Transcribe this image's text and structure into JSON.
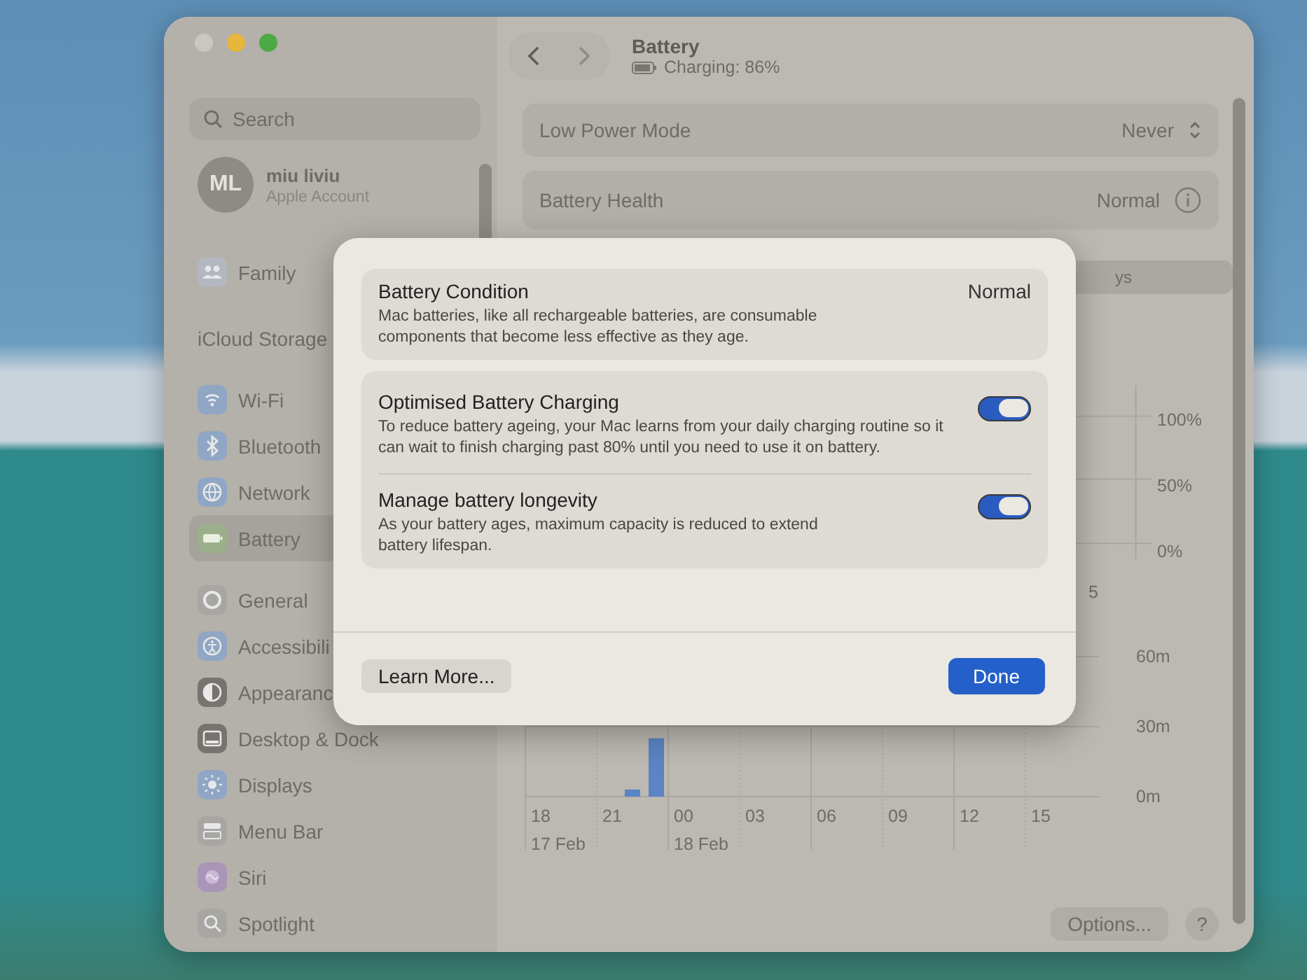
{
  "sidebar": {
    "search": {
      "placeholder": "Search"
    },
    "account": {
      "initials": "ML",
      "name": "miu liviu",
      "subtitle": "Apple Account"
    },
    "groups": [
      [
        {
          "label": "Family",
          "kind": "family",
          "selected": false,
          "color": "#b3b8c0"
        }
      ],
      [
        {
          "label": "iCloud Storage",
          "kind": "plain",
          "selected": false
        }
      ],
      [
        {
          "label": "Wi-Fi",
          "kind": "wifi",
          "selected": false,
          "color": "#8fa6c4"
        },
        {
          "label": "Bluetooth",
          "kind": "bluetooth",
          "selected": false,
          "color": "#8fa6c4"
        },
        {
          "label": "Network",
          "kind": "network",
          "selected": false,
          "color": "#8fa6c4"
        },
        {
          "label": "Battery",
          "kind": "battery",
          "selected": true,
          "color": "#9bb08a"
        }
      ],
      [
        {
          "label": "General",
          "kind": "general",
          "selected": false,
          "color": "#a8a6a3"
        },
        {
          "label": "Accessibili",
          "kind": "accessibility",
          "selected": false,
          "color": "#8fa6c4"
        },
        {
          "label": "Appearanc",
          "kind": "appearance",
          "selected": false,
          "color": "#77746f"
        },
        {
          "label": "Desktop & Dock",
          "kind": "desktop",
          "selected": false,
          "color": "#77746f"
        },
        {
          "label": "Displays",
          "kind": "displays",
          "selected": false,
          "color": "#8fa6c4"
        },
        {
          "label": "Menu Bar",
          "kind": "menubar",
          "selected": false,
          "color": "#a8a6a3"
        },
        {
          "label": "Siri",
          "kind": "siri",
          "selected": false,
          "color": "#a895b8"
        },
        {
          "label": "Spotlight",
          "kind": "spotlight",
          "selected": false,
          "color": "#a8a6a3"
        }
      ]
    ]
  },
  "header": {
    "title": "Battery",
    "status": "Charging: 86%"
  },
  "rows": [
    {
      "label": "Low Power Mode",
      "value": "Never",
      "kind": "popup"
    },
    {
      "label": "Battery Health",
      "value": "Normal",
      "kind": "info"
    }
  ],
  "segment_fragment": "ys",
  "level_chart": {
    "y_labels": [
      "100%",
      "50%",
      "0%"
    ],
    "x_label_fragment": "5"
  },
  "usage_chart": {
    "chart_data": {
      "type": "bar",
      "categories": [
        "18",
        null,
        null,
        "21",
        null,
        null,
        "00",
        null,
        null,
        "03",
        null,
        null,
        "06",
        null,
        null,
        "09",
        null,
        null,
        "12",
        null,
        null,
        "15",
        null,
        null
      ],
      "series": [
        {
          "color": "#5b84c4",
          "values": [
            0,
            0,
            0,
            0,
            3,
            25,
            0,
            0,
            0,
            0,
            0,
            0,
            0,
            0,
            0,
            0,
            0,
            0,
            0,
            0,
            0,
            0,
            0,
            0
          ]
        }
      ],
      "yticks": [
        {
          "value": 0,
          "label": "0m"
        },
        {
          "value": 30,
          "label": "30m"
        },
        {
          "value": 60,
          "label": "60m"
        }
      ],
      "ylim": [
        0,
        60
      ]
    },
    "date_labels": [
      "17 Feb",
      "18 Feb"
    ]
  },
  "footer": {
    "options": "Options...",
    "help": "?"
  },
  "sheet": {
    "condition": {
      "title": "Battery Condition",
      "value": "Normal",
      "description": "Mac batteries, like all rechargeable batteries, are consumable components that become less effective as they age."
    },
    "settings": [
      {
        "title": "Optimised Battery Charging",
        "description": "To reduce battery ageing, your Mac learns from your daily charging routine so it can wait to finish charging past 80% until you need to use it on battery.",
        "on": true
      },
      {
        "title": "Manage battery longevity",
        "description": "As your battery ages, maximum capacity is reduced to extend battery lifespan.",
        "on": true
      }
    ],
    "learn_more": "Learn More...",
    "done": "Done"
  }
}
